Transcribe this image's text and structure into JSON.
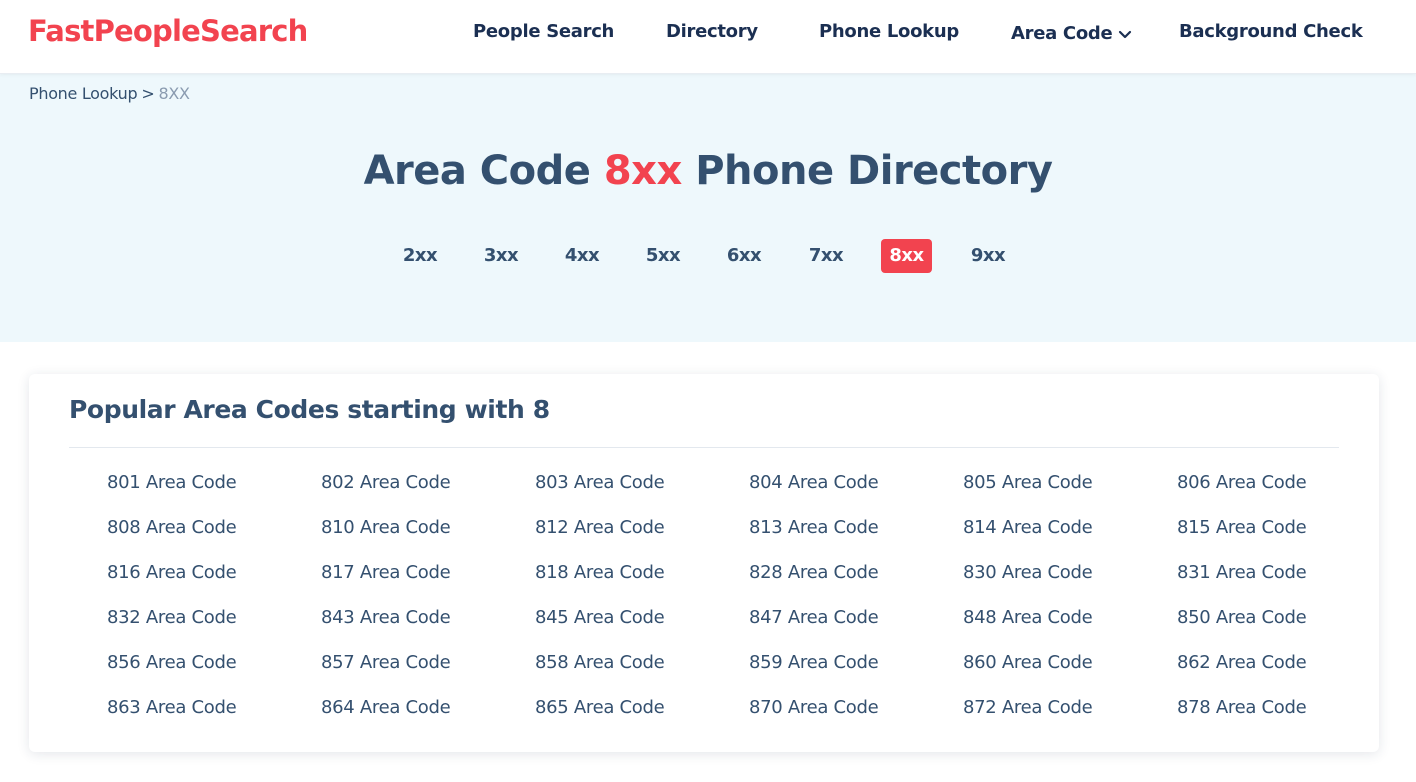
{
  "header": {
    "logo": "FastPeopleSearch",
    "nav": {
      "people_search": "People Search",
      "directory": "Directory",
      "phone_lookup": "Phone Lookup",
      "area_code": "Area Code",
      "background_check": "Background Check"
    }
  },
  "breadcrumb": {
    "parent": "Phone Lookup",
    "separator": ">",
    "current": "8XX"
  },
  "title": {
    "prefix": "Area Code",
    "accent": "8xx",
    "suffix": "Phone Directory"
  },
  "ranges": [
    "2xx",
    "3xx",
    "4xx",
    "5xx",
    "6xx",
    "7xx",
    "8xx",
    "9xx"
  ],
  "active_range": "8xx",
  "card": {
    "title": "Popular Area Codes starting with 8",
    "codes": [
      "801 Area Code",
      "802 Area Code",
      "803 Area Code",
      "804 Area Code",
      "805 Area Code",
      "806 Area Code",
      "808 Area Code",
      "810 Area Code",
      "812 Area Code",
      "813 Area Code",
      "814 Area Code",
      "815 Area Code",
      "816 Area Code",
      "817 Area Code",
      "818 Area Code",
      "828 Area Code",
      "830 Area Code",
      "831 Area Code",
      "832 Area Code",
      "843 Area Code",
      "845 Area Code",
      "847 Area Code",
      "848 Area Code",
      "850 Area Code",
      "856 Area Code",
      "857 Area Code",
      "858 Area Code",
      "859 Area Code",
      "860 Area Code",
      "862 Area Code",
      "863 Area Code",
      "864 Area Code",
      "865 Area Code",
      "870 Area Code",
      "872 Area Code",
      "878 Area Code"
    ]
  },
  "colors": {
    "brand": "#f2434f",
    "text": "#34506f",
    "nav_text": "#1b2f52",
    "hero_bg": "#eef8fc"
  },
  "icons": {
    "area_code_dropdown": "chevron-down-icon"
  }
}
